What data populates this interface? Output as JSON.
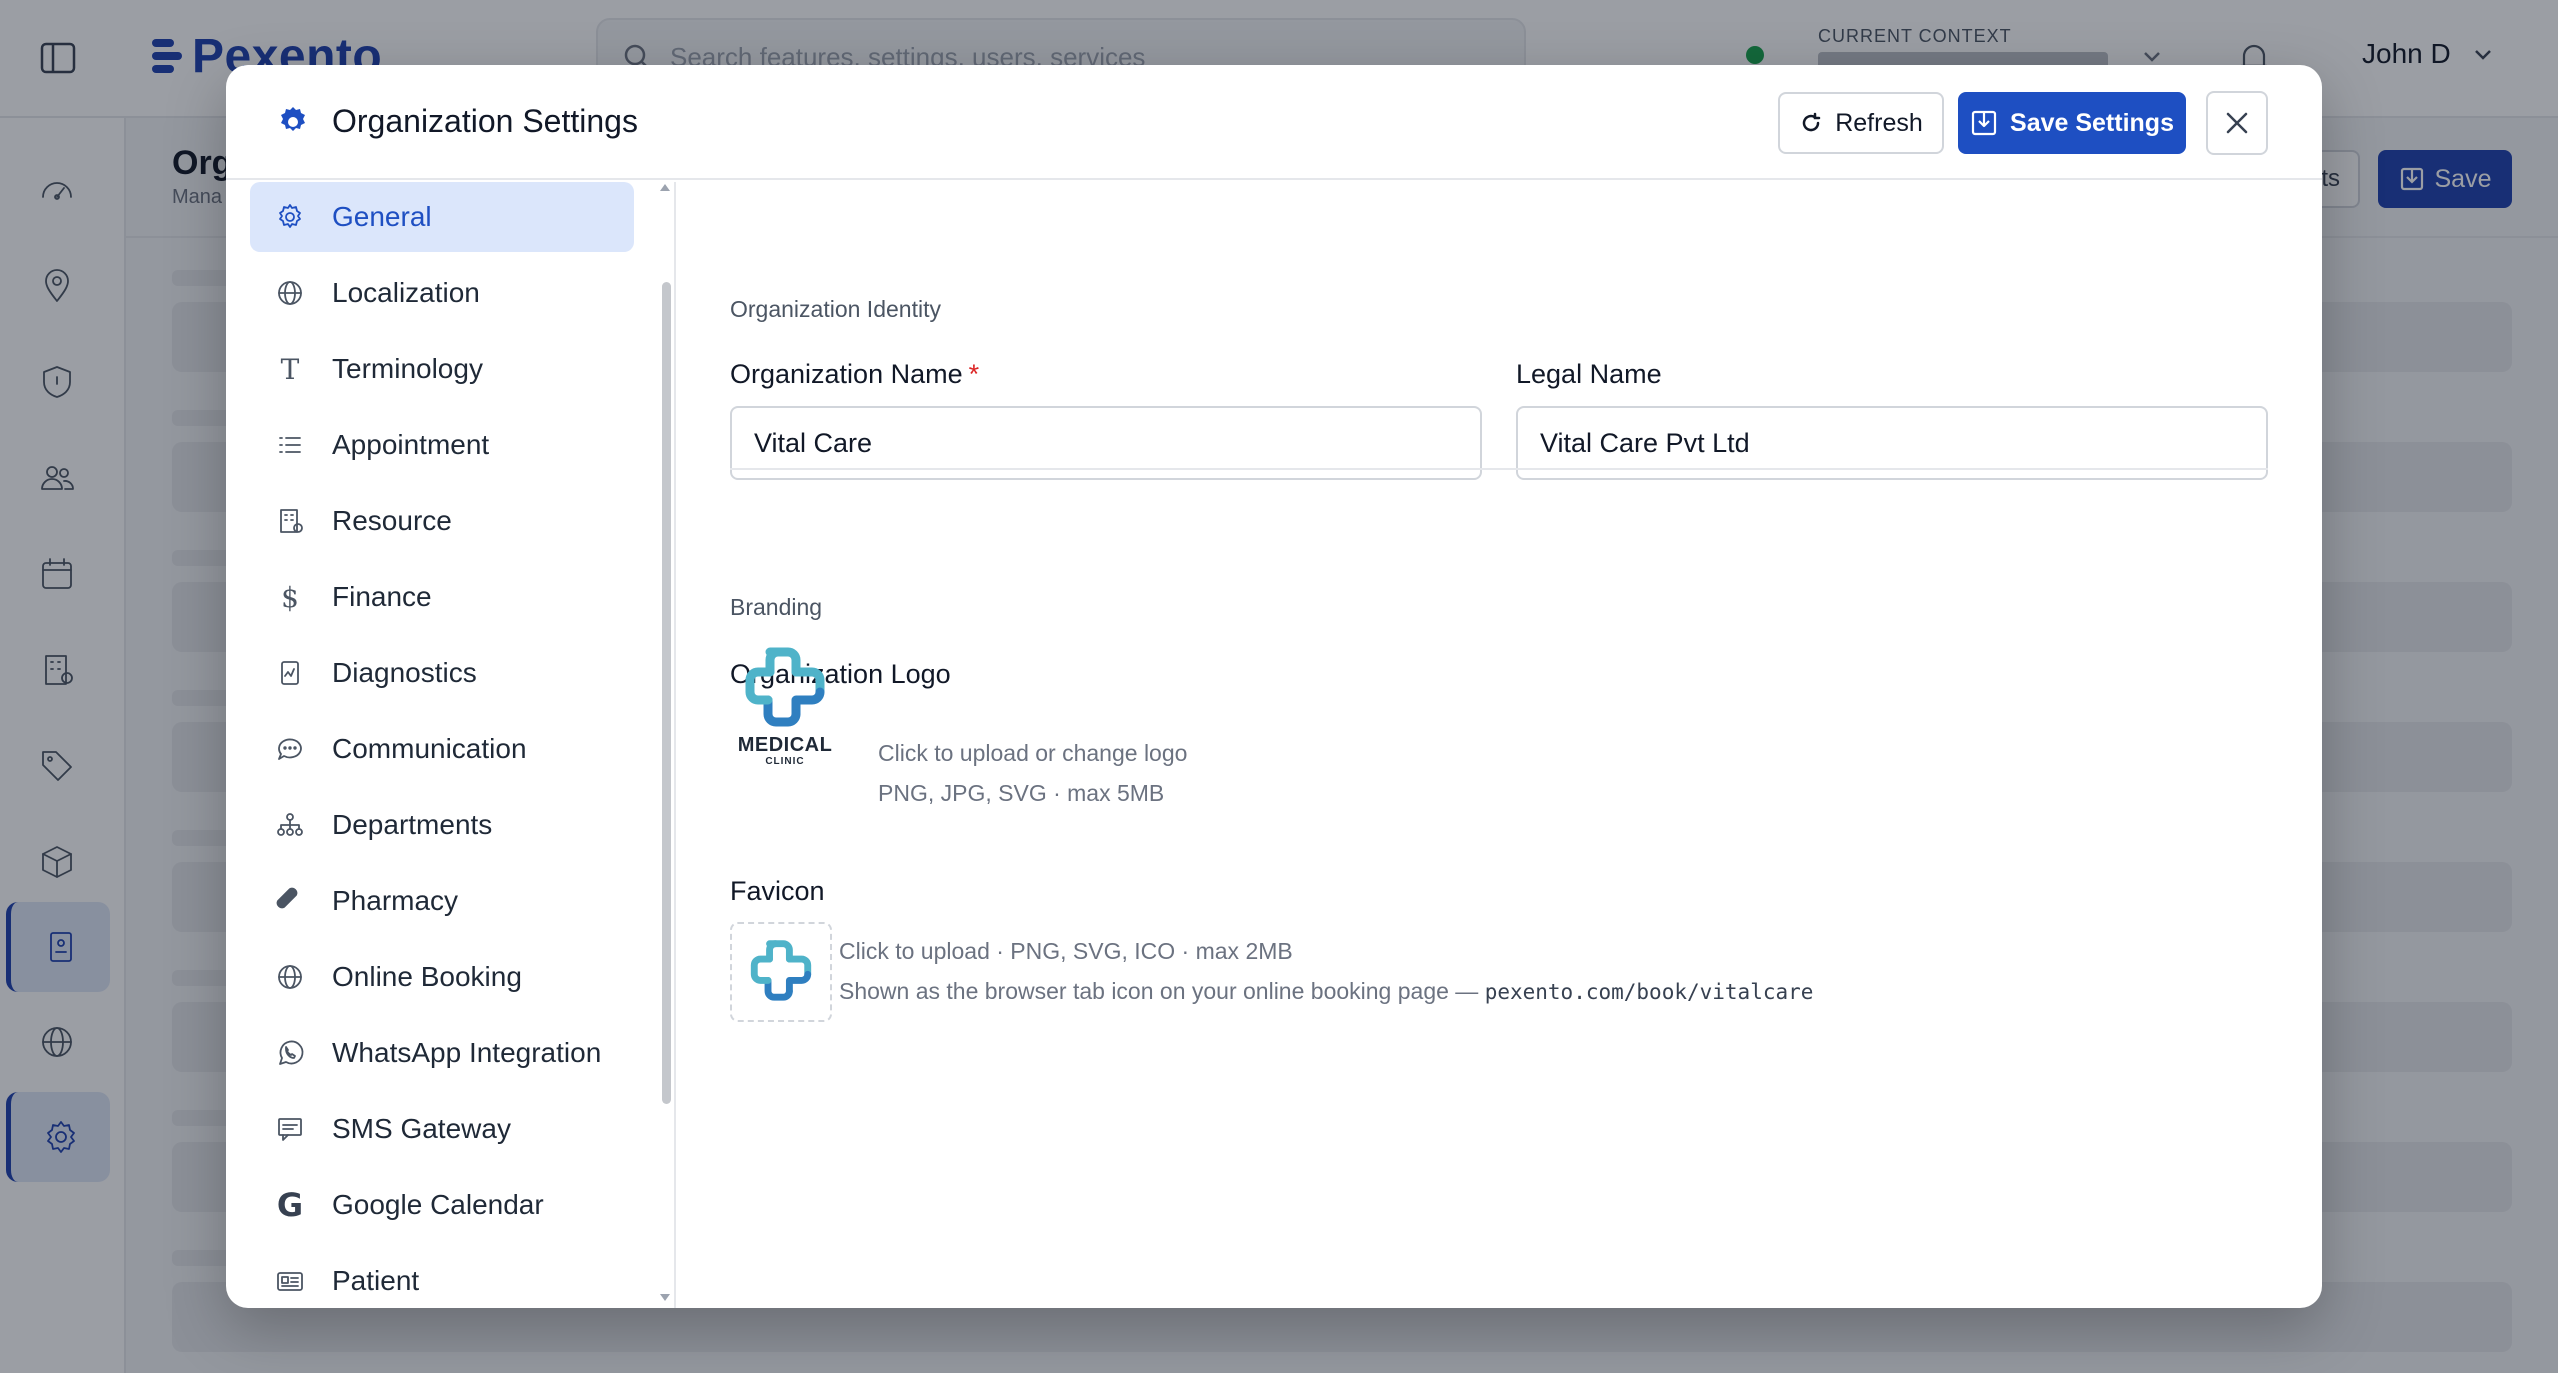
{
  "app": {
    "brand_name": "Pexento",
    "search_placeholder": "Search features, settings, users, services",
    "context_label": "CURRENT CONTEXT",
    "user_name": "John D",
    "page_title": "Org",
    "page_subtitle": "Mana",
    "header_button_partial": "ts",
    "header_save_label": "Save"
  },
  "modal": {
    "title": "Organization Settings",
    "refresh_label": "Refresh",
    "save_label": "Save Settings",
    "nav": [
      {
        "label": "General",
        "icon": "gear-icon",
        "active": true
      },
      {
        "label": "Localization",
        "icon": "globe-icon"
      },
      {
        "label": "Terminology",
        "icon": "text-icon"
      },
      {
        "label": "Appointment",
        "icon": "list-icon"
      },
      {
        "label": "Resource",
        "icon": "building-icon"
      },
      {
        "label": "Finance",
        "icon": "dollar-icon"
      },
      {
        "label": "Diagnostics",
        "icon": "report-icon"
      },
      {
        "label": "Communication",
        "icon": "chat-icon"
      },
      {
        "label": "Departments",
        "icon": "org-chart-icon"
      },
      {
        "label": "Pharmacy",
        "icon": "pill-icon"
      },
      {
        "label": "Online Booking",
        "icon": "globe-icon"
      },
      {
        "label": "WhatsApp Integration",
        "icon": "whatsapp-icon"
      },
      {
        "label": "SMS Gateway",
        "icon": "message-icon"
      },
      {
        "label": "Google Calendar",
        "icon": "google-icon"
      },
      {
        "label": "Patient",
        "icon": "id-card-icon"
      }
    ],
    "identity": {
      "section_title": "Organization Identity",
      "org_name_label": "Organization Name",
      "required_mark": "*",
      "org_name_value": "Vital Care",
      "legal_name_label": "Legal Name",
      "legal_name_value": "Vital Care Pvt Ltd"
    },
    "branding": {
      "section_title": "Branding",
      "logo_label": "Organization Logo",
      "logo_text": "MEDICAL",
      "logo_subtext": "CLINIC",
      "logo_help_1": "Click to upload or change logo",
      "logo_help_2": "PNG, JPG, SVG · max 5MB",
      "favicon_label": "Favicon",
      "favicon_help_1": "Click to upload · PNG, SVG, ICO · max 2MB",
      "favicon_help_2": "Shown as the browser tab icon on your online booking page —",
      "favicon_url": "pexento.com/book/vitalcare"
    }
  },
  "colors": {
    "primary": "#1e4fc2",
    "nav_active_bg": "#dbe6fb",
    "logo_teal": "#4fb3c9",
    "logo_blue": "#2f7fc0"
  }
}
